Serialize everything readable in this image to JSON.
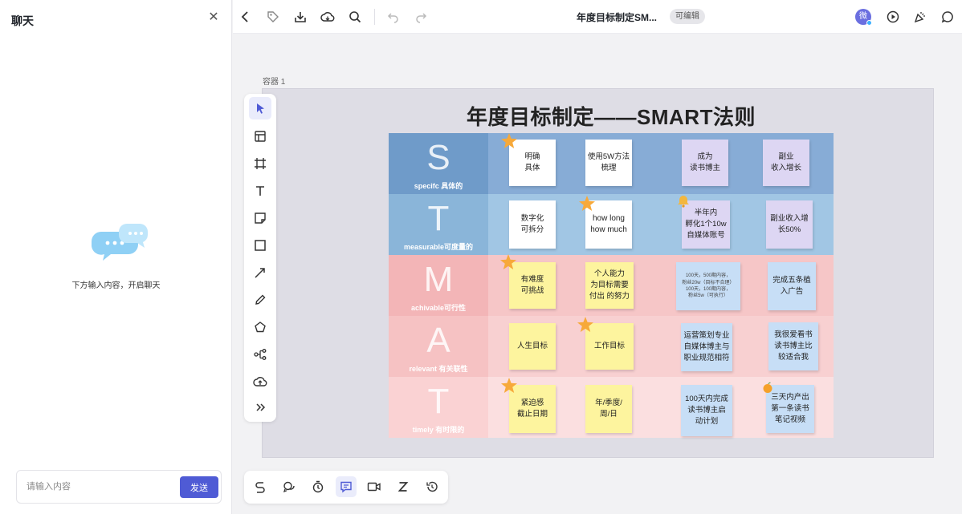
{
  "chat": {
    "title": "聊天",
    "empty_text": "下方输入内容，开启聊天",
    "input_placeholder": "请输入内容",
    "send_label": "发送"
  },
  "topbar": {
    "doc_title": "年度目标制定SM...",
    "badge": "可编辑",
    "avatar_text": "微"
  },
  "canvas": {
    "container_label": "容器 1",
    "board_title": "年度目标制定——SMART法则"
  },
  "smart": [
    {
      "letter": "S",
      "subtitle": "specifc 具体的",
      "head_color": "#6f9bc9",
      "body_color": "#87acd6",
      "notes": [
        {
          "text": "明确\n具体",
          "color": "#ffffff"
        },
        {
          "text": "使用5W方法\n梳理",
          "color": "#ffffff"
        },
        {
          "text": "成为\n读书博主",
          "color": "#ddd6f3"
        },
        {
          "text": "副业\n收入增长",
          "color": "#ddd6f3"
        }
      ]
    },
    {
      "letter": "T",
      "subtitle": "measurable可度量的",
      "head_color": "#8ab5d9",
      "body_color": "#a1c6e4",
      "notes": [
        {
          "text": "数字化\n可拆分",
          "color": "#ffffff"
        },
        {
          "text": "how long\nhow  much",
          "color": "#ffffff"
        },
        {
          "text": "半年内\n孵化1个10w\n自媒体账号",
          "color": "#ddd6f3"
        },
        {
          "text": "副业收入增\n长50%",
          "color": "#ddd6f3"
        }
      ]
    },
    {
      "letter": "M",
      "subtitle": "achivable可行性",
      "head_color": "#f3b5b7",
      "body_color": "#f6c6c7",
      "notes": [
        {
          "text": "有难度\n可挑战",
          "color": "#fdf49e"
        },
        {
          "text": "个人能力\n为目标需要\n付出 的努力",
          "color": "#fdf49e"
        },
        {
          "text": "100天，500期内容，\n粉丝20w（目标不合理）\n100天，100期内容，\n粉丝5w（可执行）",
          "color": "#c7def6"
        },
        {
          "text": "完成五条植\n入广告",
          "color": "#c7def6"
        }
      ]
    },
    {
      "letter": "A",
      "subtitle": "relevant 有关联性",
      "head_color": "#f6c2c3",
      "body_color": "#f8d0d1",
      "notes": [
        {
          "text": "人生目标",
          "color": "#fdf49e"
        },
        {
          "text": "工作目标",
          "color": "#fdf49e"
        },
        {
          "text": "运营策划专业\n自媒体博主与\n职业规范相符",
          "color": "#c7def6"
        },
        {
          "text": "我很爱看书\n读书博主比\n较适合我",
          "color": "#c7def6"
        }
      ]
    },
    {
      "letter": "T",
      "subtitle": "timely 有时限的",
      "head_color": "#fad2d3",
      "body_color": "#fbdfe0",
      "notes": [
        {
          "text": "紧迫感\n截止日期",
          "color": "#fdf49e"
        },
        {
          "text": "年/季度/\n周/日",
          "color": "#fdf49e"
        },
        {
          "text": "100天内完成\n读书博主启\n动计划",
          "color": "#c7def6"
        },
        {
          "text": "三天内产出\n第一条读书\n笔记视频",
          "color": "#c7def6"
        }
      ]
    }
  ],
  "toolbar": [
    {
      "name": "select-tool",
      "icon": "cursor-icon"
    },
    {
      "name": "template-tool",
      "icon": "layout-icon"
    },
    {
      "name": "frame-tool",
      "icon": "frame-icon"
    },
    {
      "name": "text-tool",
      "icon": "text-icon"
    },
    {
      "name": "sticky-note-tool",
      "icon": "sticky-note-icon"
    },
    {
      "name": "rectangle-tool",
      "icon": "rectangle-icon"
    },
    {
      "name": "arrow-tool",
      "icon": "arrow-icon"
    },
    {
      "name": "pen-tool",
      "icon": "pen-icon"
    },
    {
      "name": "shape-tool",
      "icon": "pentagon-icon"
    },
    {
      "name": "mindmap-tool",
      "icon": "mindmap-icon"
    },
    {
      "name": "upload-tool",
      "icon": "upload-icon"
    },
    {
      "name": "more-tools",
      "icon": "double-chevron-icon"
    }
  ],
  "accent": "#4f5bd5"
}
